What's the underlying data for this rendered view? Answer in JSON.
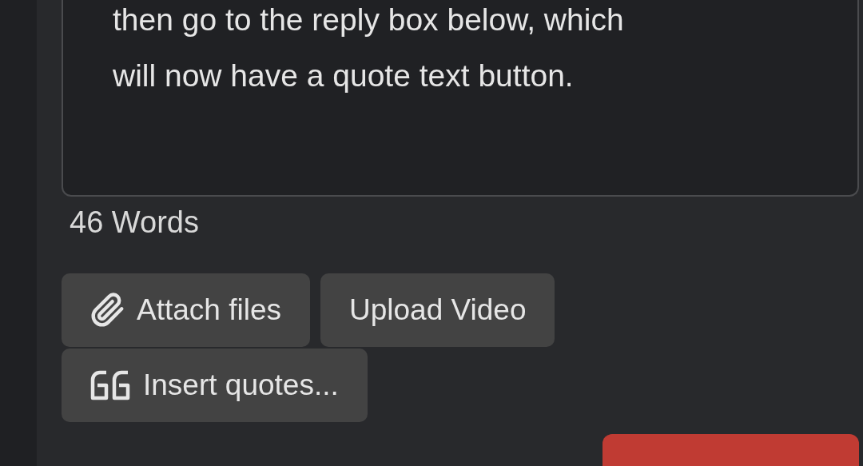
{
  "editor": {
    "lines": [
      "then go to the reply box below, which",
      "will now have a quote text button."
    ]
  },
  "word_count": "46 Words",
  "buttons": [
    {
      "kind": "attach",
      "label": "Attach files"
    },
    {
      "kind": "plain",
      "label": "Upload Video"
    },
    {
      "kind": "quote",
      "label": "Insert quotes..."
    }
  ],
  "submit_button": {
    "kind": "primary"
  }
}
